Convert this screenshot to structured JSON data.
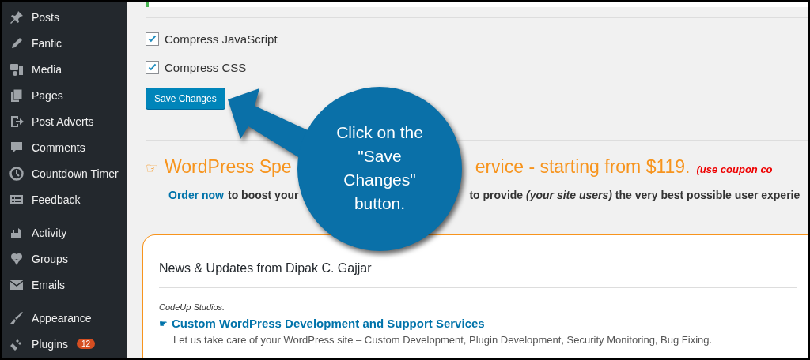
{
  "sidebar": {
    "groups": [
      {
        "items": [
          {
            "label": "Posts"
          },
          {
            "label": "Fanfic"
          },
          {
            "label": "Media"
          },
          {
            "label": "Pages"
          },
          {
            "label": "Post Adverts"
          },
          {
            "label": "Comments"
          },
          {
            "label": "Countdown Timer"
          },
          {
            "label": "Feedback"
          }
        ]
      },
      {
        "items": [
          {
            "label": "Activity"
          },
          {
            "label": "Groups"
          },
          {
            "label": "Emails"
          }
        ]
      },
      {
        "items": [
          {
            "label": "Appearance"
          },
          {
            "label": "Plugins",
            "badge": "12"
          }
        ]
      }
    ]
  },
  "options": [
    {
      "label": "Compress JavaScript",
      "checked": true
    },
    {
      "label": "Compress CSS",
      "checked": true
    }
  ],
  "save_button": "Save Changes",
  "promo": {
    "hand": "☞",
    "headline_start": "WordPress Spe",
    "headline_end": "ervice - starting from $119.",
    "coupon": "(use coupon co",
    "link": "Order now",
    "text_start": "to boost your",
    "text_end": "to provide *(your site users)* the very best possible user experie"
  },
  "callout": "Click on the \"Save Changes\" button.",
  "news": {
    "title": "News & Updates from Dipak C. Gajjar",
    "source": "CodeUp Studios.",
    "hand": "☛",
    "link": "Custom WordPress Development and Support Services",
    "excerpt": "Let us take care of your WordPress site – Custom Development, Plugin Development, Security Monitoring, Bug Fixing."
  }
}
